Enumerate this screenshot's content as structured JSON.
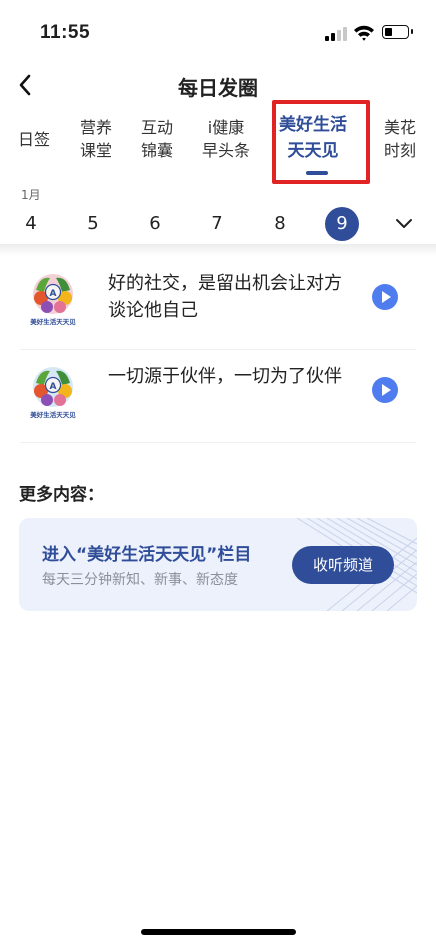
{
  "status_bar": {
    "time": "11:55"
  },
  "header": {
    "title": "每日发圈"
  },
  "tabs": [
    {
      "label": "日签"
    },
    {
      "label": "营养\n课堂"
    },
    {
      "label": "互动\n锦囊"
    },
    {
      "label": "i健康\n早头条"
    },
    {
      "label": "美好生活\n天天见"
    },
    {
      "label": "美花\n时刻"
    }
  ],
  "date_bar": {
    "month": "1月",
    "days": [
      "4",
      "5",
      "6",
      "7",
      "8",
      "9"
    ],
    "selected_day": "9"
  },
  "items": [
    {
      "thumb_caption": "美好生活天天见",
      "text": "好的社交，是留出机会让对方谈论他自己"
    },
    {
      "thumb_caption": "美好生活天天见",
      "text": "一切源于伙伴，一切为了伙伴"
    }
  ],
  "more": {
    "title": "更多内容：",
    "banner_title": "进入“美好生活天天见”栏目",
    "banner_subtitle": "每天三分钟新知、新事、新态度",
    "button_label": "收听频道"
  },
  "colors": {
    "accent": "#2f4d98",
    "play": "#4f7df0",
    "highlight": "#e02424"
  }
}
